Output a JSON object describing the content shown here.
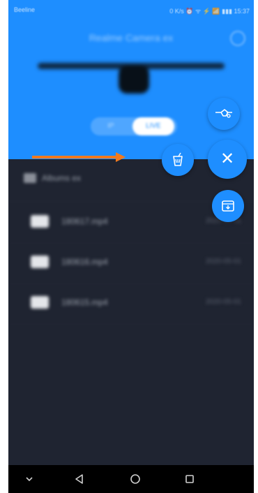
{
  "status_bar": {
    "carrier": "Beeline",
    "right_text": "0 K/s ⏰ ᯤ ⚡ 📶 ▮▮▮ 15:37"
  },
  "header": {
    "title": "Realme Camera ex",
    "background_color": "#1e8eff"
  },
  "mode_toggle": {
    "option_a": "IP",
    "option_b": "LIVE"
  },
  "folder": {
    "name": "Albums ex",
    "icon": "folder-icon"
  },
  "files": [
    {
      "name": "180617.mp4",
      "date": "2020-05-01",
      "icon": "file-icon"
    },
    {
      "name": "180616.mp4",
      "date": "2020-05-01",
      "icon": "file-icon"
    },
    {
      "name": "180615.mp4",
      "date": "2020-05-01",
      "icon": "file-icon"
    }
  ],
  "fab_menu": {
    "drone_button_icon": "drone-icon",
    "close_button_icon": "close-icon",
    "close_glyph": "✕",
    "glass_button_icon": "drink-icon",
    "download_button_icon": "download-icon",
    "accent_color": "#1e8eff"
  },
  "annotation_arrow": {
    "color": "#f07a1f"
  },
  "nav_bar": {
    "items": [
      "chevron-down-icon",
      "back-icon",
      "home-icon",
      "recents-icon"
    ]
  }
}
